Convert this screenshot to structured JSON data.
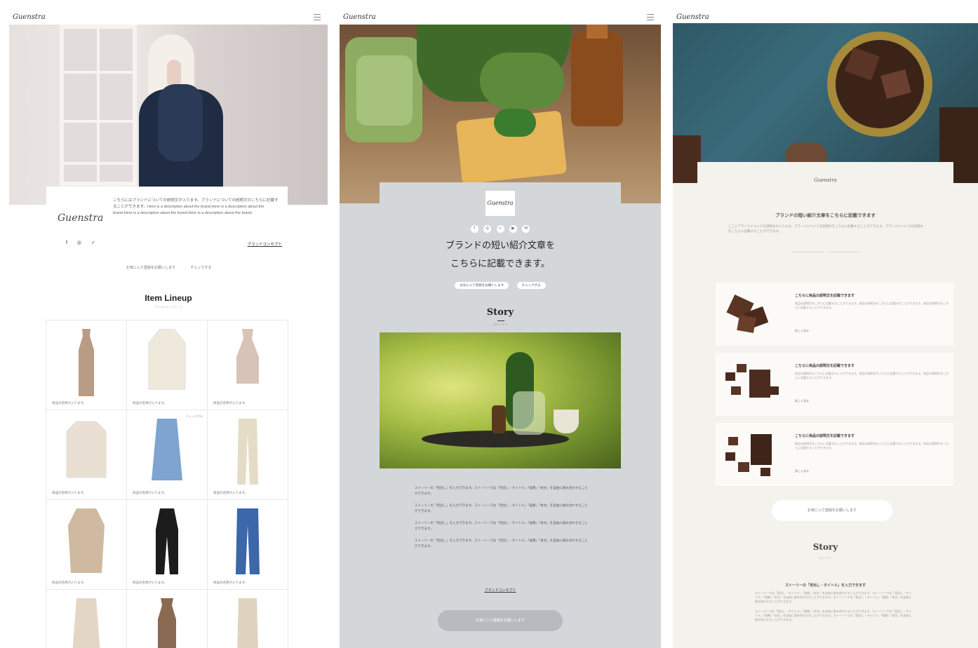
{
  "colors": {
    "panel2_bg": "#d4d7d9",
    "panel3_bg": "#f3f2ec",
    "dark_text": "#222222",
    "button_grey": "#b7bbbf"
  },
  "panel1": {
    "logo": "Guenstra",
    "hero_alt": "woman in navy scarf",
    "brand_logo": "Guenstra",
    "brand_description": "こちらにはブランドについての説明文が入ります。ブランドについての説明文のこちらに記載することができます。Here is a description about the brand.Here is a description about the brand.Here is a description about the brand.Here is a description about the brand.",
    "social_icons": [
      "facebook-icon",
      "instagram-icon",
      "twitter-icon"
    ],
    "social_glyphs": "f ◎ ✓",
    "concept_link": "ブランドコンセプト",
    "buttons": [
      "お気に入り登録をお願いします",
      "チェックする"
    ],
    "section_title": "Item Lineup",
    "section_subtitle": "アイテムラインナップ",
    "items": [
      "商品の名称が入ります。",
      "商品の名称が入ります。",
      "商品の名称が入ります。",
      "商品の名称が入ります。",
      "商品の名称が入ります。",
      "商品の名称が入ります。",
      "商品の名称が入ります。",
      "商品の名称が入ります。",
      "商品の名称が入ります。",
      "",
      "",
      ""
    ],
    "item_chip": "チェックする"
  },
  "panel2": {
    "logo": "Guenstra",
    "brand_logo": "Guenstra",
    "social_icons": [
      "f",
      "◎",
      "✓",
      "▶",
      "✉"
    ],
    "title_line1": "ブランドの短い紹介文章を",
    "title_line2": "こちらに記載できます。",
    "buttons": [
      "お気に入り登録をお願いします",
      "チェックする"
    ],
    "story_title": "Story",
    "story_subtitle": "ストーリー",
    "story_paragraphs": [
      "ストーリーの「見出し」を入力できます。ストーリーでは「見出し・タイトル」「画像」「本文」を自由に組み合わせることができます。",
      "ストーリーの「見出し」を入力できます。ストーリーでは「見出し・タイトル」「画像」「本文」を自由に組み合わせることができます。",
      "ストーリーの「見出し」を入力できます。ストーリーでは「見出し・タイトル」「画像」「本文」を自由に組み合わせることができます。",
      "ストーリーの「見出し」を入力できます。ストーリーでは「見出し・タイトル」「画像」「本文」を自由に組み合わせることができます。"
    ],
    "concept_link": "ブランドコンセプト",
    "big_button": "お気に入り登録をお願いします"
  },
  "panel3": {
    "logo": "Guenstra",
    "brand_logo": "Guenstra",
    "title": "ブランドの短い紹介文章をこちらに記載できます",
    "description": "ここにブランドについての説明文が入ります。ブランドについての説明文をこちらに記載することができます。ブランドについての説明文をこちらに記載することができます。",
    "items": [
      {
        "title": "こちらに商品の説明文を記載できます",
        "desc": "商品の説明文をこちらに記載することができます。商品の説明文をこちらに記載することができます。商品の説明文をこちらに記載することができます。",
        "more": "詳しく見る"
      },
      {
        "title": "こちらに商品の説明文を記載できます",
        "desc": "商品の説明文をこちらに記載することができます。商品の説明文をこちらに記載することができます。商品の説明文をこちらに記載することができます。",
        "more": "詳しく見る"
      },
      {
        "title": "こちらに商品の説明文を記載できます",
        "desc": "商品の説明文をこちらに記載することができます。商品の説明文をこちらに記載することができます。商品の説明文をこちらに記載することができます。",
        "more": "詳しく見る"
      }
    ],
    "button": "お気に入り登録をお願いします",
    "story_title": "Story",
    "story_subtitle": "ストーリー",
    "story_heading": "ストーリーの「見出し・タイトル」を入力できます",
    "story_paragraphs": [
      "ストーリーでは「見出し・タイトル」「画像」「本文」を自由に組み合わせることができます。ストーリーでは「見出し・タイトル」「画像」「本文」を自由に組み合わせることができます。ストーリーでは「見出し・タイトル」「画像」「本文」を自由に組み合わせることができます。",
      "ストーリーでは「見出し・タイトル」「画像」「本文」を自由に組み合わせることができます。ストーリーでは「見出し・タイトル」「画像」「本文」を自由に組み合わせることができます。ストーリーでは「見出し・タイトル」「画像」「本文」を自由に組み合わせることができます。"
    ]
  }
}
